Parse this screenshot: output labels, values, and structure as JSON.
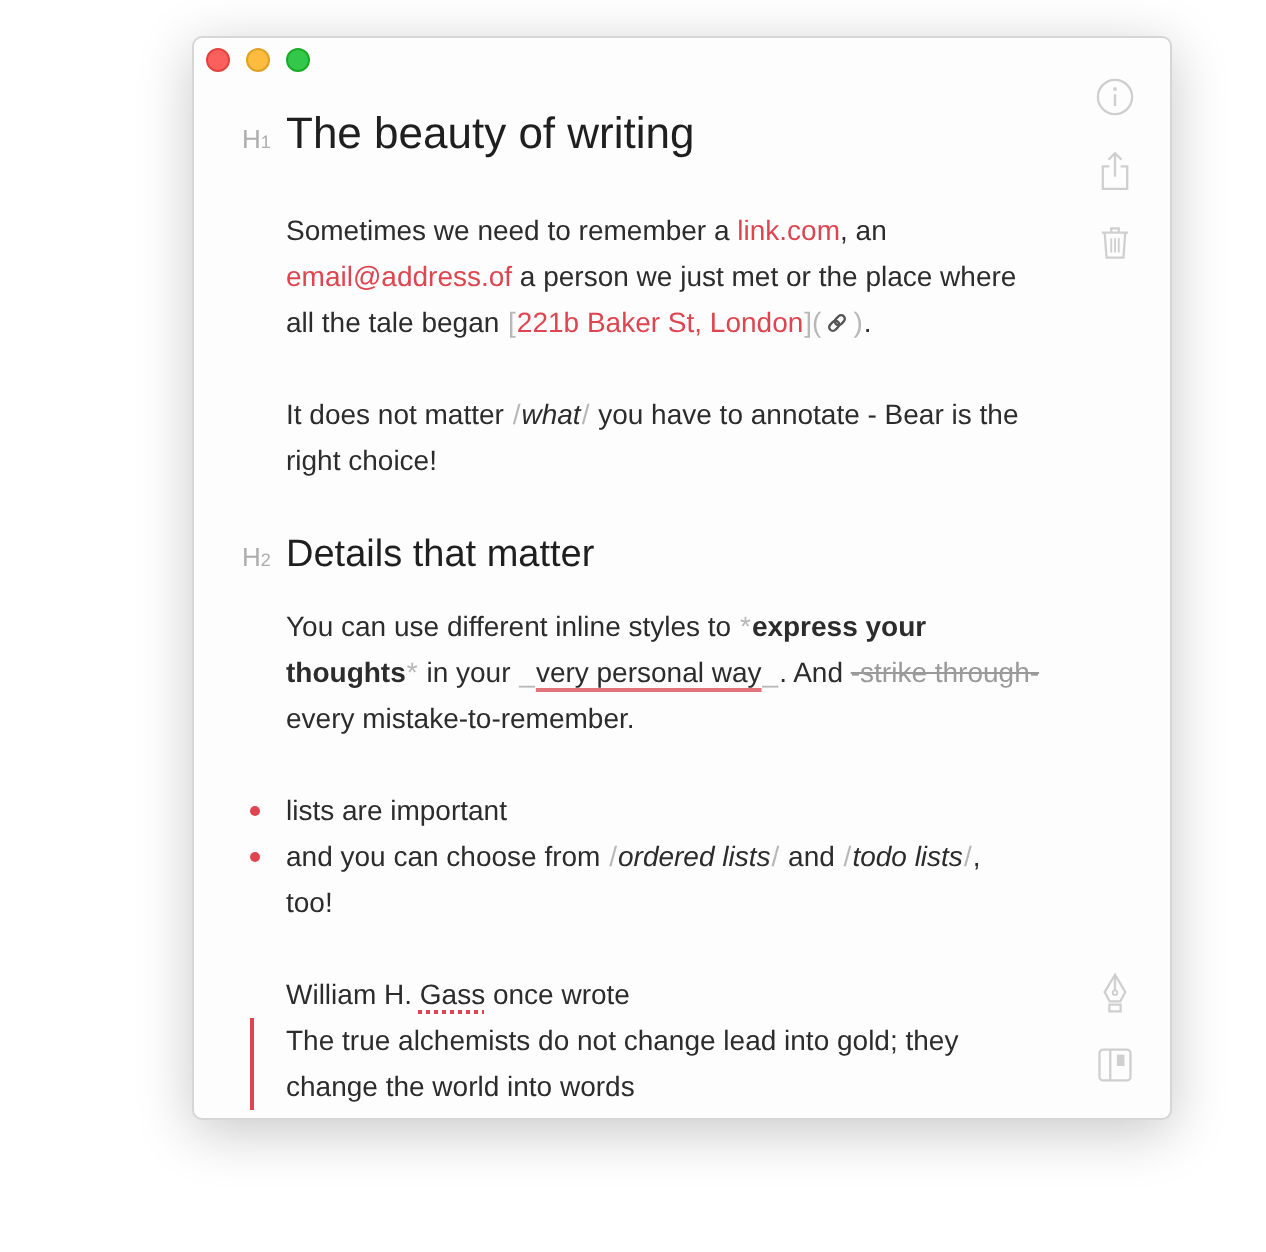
{
  "document": {
    "blocks": [
      {
        "kind": "h1",
        "marker": "H$_{1}$",
        "text": "The beauty of writing"
      },
      {
        "kind": "paragraph",
        "segments": [
          {
            "kind": "text",
            "text": "Sometimes we need to remember a "
          },
          {
            "kind": "link",
            "text": "link.com"
          },
          {
            "kind": "text",
            "text": ", an "
          },
          {
            "kind": "link",
            "text": "email@address.of"
          },
          {
            "kind": "text",
            "text": " a person we just met or the place where all the tale began "
          },
          {
            "kind": "marker",
            "text": "["
          },
          {
            "kind": "link",
            "text": "221b Baker St, London"
          },
          {
            "kind": "marker",
            "text": "]("
          },
          {
            "kind": "link_icon"
          },
          {
            "kind": "marker",
            "text": ")"
          },
          {
            "kind": "text",
            "text": "."
          }
        ]
      },
      {
        "kind": "paragraph",
        "segments": [
          {
            "kind": "text",
            "text": "It does not matter "
          },
          {
            "kind": "marker",
            "text": "/"
          },
          {
            "kind": "italic",
            "text": "what"
          },
          {
            "kind": "marker",
            "text": "/"
          },
          {
            "kind": "text",
            "text": " you have to annotate - Bear is the right choice!"
          }
        ]
      },
      {
        "kind": "h2",
        "marker": "H$_{2}$",
        "text": "Details that matter"
      },
      {
        "kind": "paragraph",
        "segments": [
          {
            "kind": "text",
            "text": "You can use different inline styles to "
          },
          {
            "kind": "marker",
            "text": "*"
          },
          {
            "kind": "bold",
            "text": "express your thoughts"
          },
          {
            "kind": "marker",
            "text": "*"
          },
          {
            "kind": "text",
            "text": " in your "
          },
          {
            "kind": "marker",
            "text": "_"
          },
          {
            "kind": "underline",
            "text": "very personal way"
          },
          {
            "kind": "marker",
            "text": "_"
          },
          {
            "kind": "text",
            "text": ". And "
          },
          {
            "kind": "strike",
            "text": "-strike through-"
          },
          {
            "kind": "text",
            "text": " every mistake-to-remember."
          }
        ]
      },
      {
        "kind": "list",
        "items": [
          {
            "segments": [
              {
                "kind": "text",
                "text": "lists are important"
              }
            ]
          },
          {
            "segments": [
              {
                "kind": "text",
                "text": "and you can choose from "
              },
              {
                "kind": "marker",
                "text": "/"
              },
              {
                "kind": "italic",
                "text": "ordered lists"
              },
              {
                "kind": "marker",
                "text": "/"
              },
              {
                "kind": "text",
                "text": " and "
              },
              {
                "kind": "marker",
                "text": "/"
              },
              {
                "kind": "italic",
                "text": "todo lists"
              },
              {
                "kind": "marker",
                "text": "/"
              },
              {
                "kind": "text",
                "text": ", too!"
              }
            ]
          }
        ]
      },
      {
        "kind": "quotation",
        "lead": [
          {
            "kind": "text",
            "text": "William H. "
          },
          {
            "kind": "misspelled",
            "text": "Gass"
          },
          {
            "kind": "text",
            "text": " once wrote"
          }
        ],
        "quote": "The true alchemists do not change lead into gold; they change the world into words"
      }
    ]
  }
}
